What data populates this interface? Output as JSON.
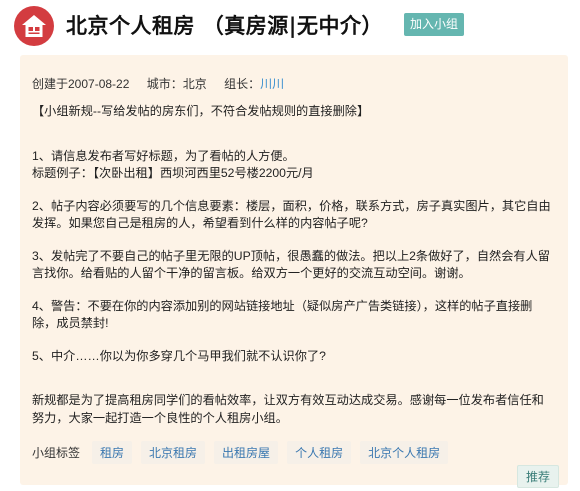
{
  "header": {
    "logo_icon": "home-logo-icon",
    "title": "北京个人租房 （真房源|无中介）",
    "join_label": "加入小组"
  },
  "meta": {
    "created": "创建于2007-08-22",
    "city": "城市：北京",
    "leader_prefix": "组长：",
    "leader_name": "川川"
  },
  "content": {
    "rule_notice": "【小组新规--写给发帖的房东们，不符合发帖规则的直接删除】",
    "item1": "1、请信息发布者写好标题，为了看帖的人方便。",
    "item1_example": "标题例子：【次卧出租】西坝河西里52号楼2200元/月",
    "item2": "2、帖子内容必须要写的几个信息要素：楼层，面积，价格，联系方式，房子真实图片，其它自由发挥。如果您自己是租房的人，希望看到什么样的内容帖子呢?",
    "item3": "3、发帖完了不要自己的帖子里无限的UP顶帖，很愚蠢的做法。把以上2条做好了，自然会有人留言找你。给看贴的人留个干净的留言板。给双方一个更好的交流互动空间。谢谢。",
    "item4": "4、警告：不要在你的内容添加别的网站链接地址（疑似房产广告类链接），这样的帖子直接删除，成员禁封!",
    "item5": "5、中介……你以为你多穿几个马甲我们就不认识你了?",
    "closing": "新规都是为了提高租房同学们的看帖效率，让双方有效互动达成交易。感谢每一位发布者信任和努力，大家一起打造一个良性的个人租房小组。"
  },
  "tags": {
    "label": "小组标签",
    "items": [
      "租房",
      "北京租房",
      "出租房屋",
      "个人租房",
      "北京个人租房"
    ]
  },
  "recommend_label": "推荐",
  "colors": {
    "logo_red": "#d33c40",
    "join_button": "#65b6b0",
    "panel_bg": "#fdf3e7",
    "link_blue": "#3a8fcf"
  }
}
